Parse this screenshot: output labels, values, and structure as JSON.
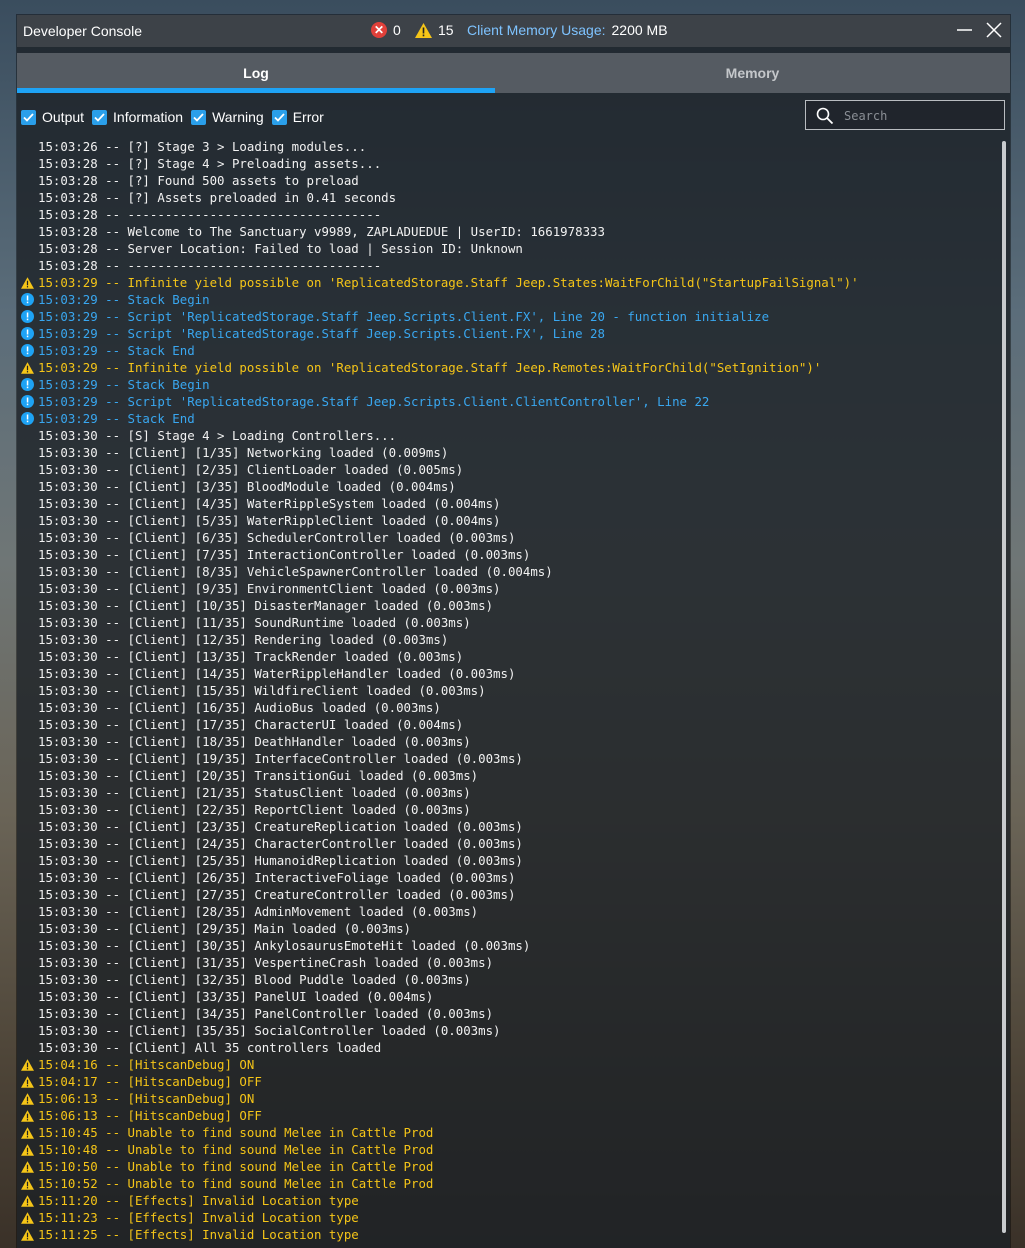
{
  "window": {
    "title": "Developer Console",
    "error_count": "0",
    "warning_count": "15",
    "memory_label": "Client Memory Usage:",
    "memory_value": "2200 MB"
  },
  "tabs": [
    {
      "label": "Log",
      "active": true
    },
    {
      "label": "Memory",
      "active": false
    }
  ],
  "filters": [
    {
      "label": "Output",
      "checked": true
    },
    {
      "label": "Information",
      "checked": true
    },
    {
      "label": "Warning",
      "checked": true
    },
    {
      "label": "Error",
      "checked": true
    }
  ],
  "search": {
    "placeholder": "Search",
    "value": ""
  },
  "colors": {
    "output": "#f2f2f2",
    "warning": "#f5c518",
    "info": "#39a7f0",
    "accent": "#1ea3f5"
  },
  "log": [
    {
      "type": "output",
      "text": "15:03:26 -- [?] Stage 3 > Loading modules..."
    },
    {
      "type": "output",
      "text": "15:03:28 -- [?] Stage 4 > Preloading assets..."
    },
    {
      "type": "output",
      "text": "15:03:28 -- [?] Found 500 assets to preload"
    },
    {
      "type": "output",
      "text": "15:03:28 -- [?] Assets preloaded in 0.41 seconds"
    },
    {
      "type": "output",
      "text": "15:03:28 -- ----------------------------------"
    },
    {
      "type": "output",
      "text": "15:03:28 -- Welcome to The Sanctuary v9989, ZAPLADUEDUE | UserID: 1661978333"
    },
    {
      "type": "output",
      "text": "15:03:28 -- Server Location: Failed to load | Session ID: Unknown"
    },
    {
      "type": "output",
      "text": "15:03:28 -- ----------------------------------"
    },
    {
      "type": "warning",
      "text": "15:03:29 -- Infinite yield possible on 'ReplicatedStorage.Staff Jeep.States:WaitForChild(\"StartupFailSignal\")'"
    },
    {
      "type": "info",
      "text": "15:03:29 -- Stack Begin"
    },
    {
      "type": "info",
      "text": "15:03:29 -- Script 'ReplicatedStorage.Staff Jeep.Scripts.Client.FX', Line 20 - function initialize"
    },
    {
      "type": "info",
      "text": "15:03:29 -- Script 'ReplicatedStorage.Staff Jeep.Scripts.Client.FX', Line 28"
    },
    {
      "type": "info",
      "text": "15:03:29 -- Stack End"
    },
    {
      "type": "warning",
      "text": "15:03:29 -- Infinite yield possible on 'ReplicatedStorage.Staff Jeep.Remotes:WaitForChild(\"SetIgnition\")'"
    },
    {
      "type": "info",
      "text": "15:03:29 -- Stack Begin"
    },
    {
      "type": "info",
      "text": "15:03:29 -- Script 'ReplicatedStorage.Staff Jeep.Scripts.Client.ClientController', Line 22"
    },
    {
      "type": "info",
      "text": "15:03:29 -- Stack End"
    },
    {
      "type": "output",
      "text": "15:03:30 -- [S] Stage 4 > Loading Controllers..."
    },
    {
      "type": "output",
      "text": "15:03:30 -- [Client] [1/35] Networking loaded (0.009ms)"
    },
    {
      "type": "output",
      "text": "15:03:30 -- [Client] [2/35] ClientLoader loaded (0.005ms)"
    },
    {
      "type": "output",
      "text": "15:03:30 -- [Client] [3/35] BloodModule loaded (0.004ms)"
    },
    {
      "type": "output",
      "text": "15:03:30 -- [Client] [4/35] WaterRippleSystem loaded (0.004ms)"
    },
    {
      "type": "output",
      "text": "15:03:30 -- [Client] [5/35] WaterRippleClient loaded (0.004ms)"
    },
    {
      "type": "output",
      "text": "15:03:30 -- [Client] [6/35] SchedulerController loaded (0.003ms)"
    },
    {
      "type": "output",
      "text": "15:03:30 -- [Client] [7/35] InteractionController loaded (0.003ms)"
    },
    {
      "type": "output",
      "text": "15:03:30 -- [Client] [8/35] VehicleSpawnerController loaded (0.004ms)"
    },
    {
      "type": "output",
      "text": "15:03:30 -- [Client] [9/35] EnvironmentClient loaded (0.003ms)"
    },
    {
      "type": "output",
      "text": "15:03:30 -- [Client] [10/35] DisasterManager loaded (0.003ms)"
    },
    {
      "type": "output",
      "text": "15:03:30 -- [Client] [11/35] SoundRuntime loaded (0.003ms)"
    },
    {
      "type": "output",
      "text": "15:03:30 -- [Client] [12/35] Rendering loaded (0.003ms)"
    },
    {
      "type": "output",
      "text": "15:03:30 -- [Client] [13/35] TrackRender loaded (0.003ms)"
    },
    {
      "type": "output",
      "text": "15:03:30 -- [Client] [14/35] WaterRippleHandler loaded (0.003ms)"
    },
    {
      "type": "output",
      "text": "15:03:30 -- [Client] [15/35] WildfireClient loaded (0.003ms)"
    },
    {
      "type": "output",
      "text": "15:03:30 -- [Client] [16/35] AudioBus loaded (0.003ms)"
    },
    {
      "type": "output",
      "text": "15:03:30 -- [Client] [17/35] CharacterUI loaded (0.004ms)"
    },
    {
      "type": "output",
      "text": "15:03:30 -- [Client] [18/35] DeathHandler loaded (0.003ms)"
    },
    {
      "type": "output",
      "text": "15:03:30 -- [Client] [19/35] InterfaceController loaded (0.003ms)"
    },
    {
      "type": "output",
      "text": "15:03:30 -- [Client] [20/35] TransitionGui loaded (0.003ms)"
    },
    {
      "type": "output",
      "text": "15:03:30 -- [Client] [21/35] StatusClient loaded (0.003ms)"
    },
    {
      "type": "output",
      "text": "15:03:30 -- [Client] [22/35] ReportClient loaded (0.003ms)"
    },
    {
      "type": "output",
      "text": "15:03:30 -- [Client] [23/35] CreatureReplication loaded (0.003ms)"
    },
    {
      "type": "output",
      "text": "15:03:30 -- [Client] [24/35] CharacterController loaded (0.003ms)"
    },
    {
      "type": "output",
      "text": "15:03:30 -- [Client] [25/35] HumanoidReplication loaded (0.003ms)"
    },
    {
      "type": "output",
      "text": "15:03:30 -- [Client] [26/35] InteractiveFoliage loaded (0.003ms)"
    },
    {
      "type": "output",
      "text": "15:03:30 -- [Client] [27/35] CreatureController loaded (0.003ms)"
    },
    {
      "type": "output",
      "text": "15:03:30 -- [Client] [28/35] AdminMovement loaded (0.003ms)"
    },
    {
      "type": "output",
      "text": "15:03:30 -- [Client] [29/35] Main loaded (0.003ms)"
    },
    {
      "type": "output",
      "text": "15:03:30 -- [Client] [30/35] AnkylosaurusEmoteHit loaded (0.003ms)"
    },
    {
      "type": "output",
      "text": "15:03:30 -- [Client] [31/35] VespertineCrash loaded (0.003ms)"
    },
    {
      "type": "output",
      "text": "15:03:30 -- [Client] [32/35] Blood Puddle loaded (0.003ms)"
    },
    {
      "type": "output",
      "text": "15:03:30 -- [Client] [33/35] PanelUI loaded (0.004ms)"
    },
    {
      "type": "output",
      "text": "15:03:30 -- [Client] [34/35] PanelController loaded (0.003ms)"
    },
    {
      "type": "output",
      "text": "15:03:30 -- [Client] [35/35] SocialController loaded (0.003ms)"
    },
    {
      "type": "output",
      "text": "15:03:30 -- [Client] All 35 controllers loaded"
    },
    {
      "type": "warning",
      "text": "15:04:16 -- [HitscanDebug] ON"
    },
    {
      "type": "warning",
      "text": "15:04:17 -- [HitscanDebug] OFF"
    },
    {
      "type": "warning",
      "text": "15:06:13 -- [HitscanDebug] ON"
    },
    {
      "type": "warning",
      "text": "15:06:13 -- [HitscanDebug] OFF"
    },
    {
      "type": "warning",
      "text": "15:10:45 -- Unable to find sound Melee in Cattle Prod"
    },
    {
      "type": "warning",
      "text": "15:10:48 -- Unable to find sound Melee in Cattle Prod"
    },
    {
      "type": "warning",
      "text": "15:10:50 -- Unable to find sound Melee in Cattle Prod"
    },
    {
      "type": "warning",
      "text": "15:10:52 -- Unable to find sound Melee in Cattle Prod"
    },
    {
      "type": "warning",
      "text": "15:11:20 -- [Effects] Invalid Location type"
    },
    {
      "type": "warning",
      "text": "15:11:23 -- [Effects] Invalid Location type"
    },
    {
      "type": "warning",
      "text": "15:11:25 -- [Effects] Invalid Location type"
    }
  ]
}
